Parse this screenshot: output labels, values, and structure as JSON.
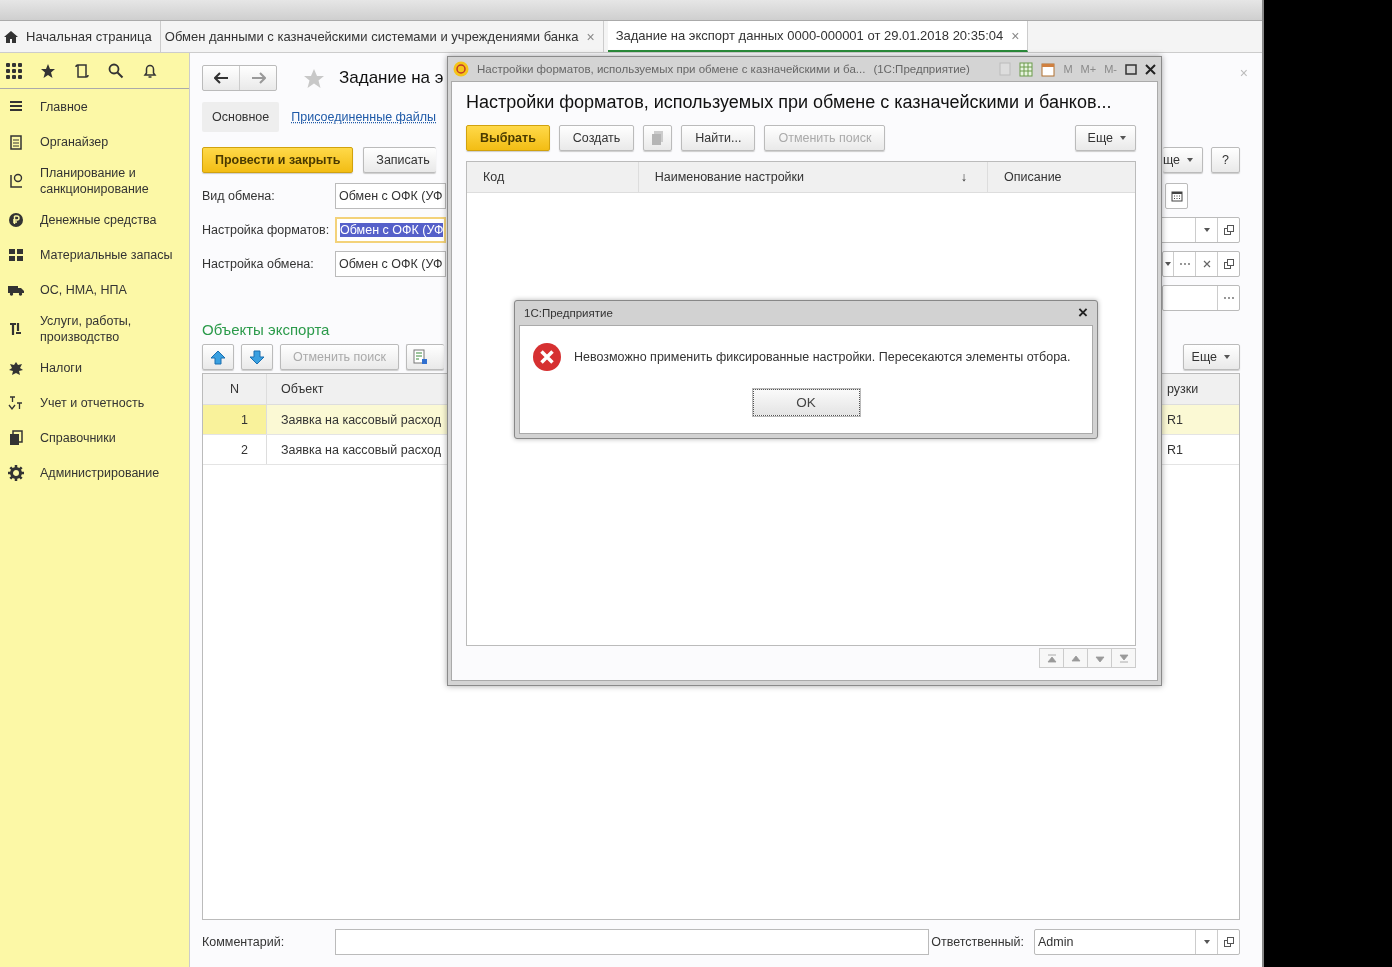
{
  "tabs": [
    {
      "label": "Начальная страница",
      "kind": "home",
      "selected": false
    },
    {
      "label": "Обмен данными с казначейскими системами и учреждениями банка",
      "kind": "doc",
      "selected": false,
      "close": "×"
    },
    {
      "label": "Задание на экспорт данных 0000-000001 от 29.01.2018 20:35:04",
      "kind": "doc",
      "selected": true,
      "close": "×"
    }
  ],
  "sidebar": {
    "items": [
      {
        "label": "Главное"
      },
      {
        "label": "Органайзер"
      },
      {
        "label": "Планирование и санкционирование"
      },
      {
        "label": "Денежные средства"
      },
      {
        "label": "Материальные запасы"
      },
      {
        "label": "ОС, НМА, НПА"
      },
      {
        "label": "Услуги, работы, производство"
      },
      {
        "label": "Налоги"
      },
      {
        "label": "Учет и отчетность"
      },
      {
        "label": "Справочники"
      },
      {
        "label": "Администрирование"
      }
    ]
  },
  "form": {
    "title": "Задание на э",
    "close": "×",
    "tabs": [
      {
        "label": "Основное",
        "selected": true
      },
      {
        "label": "Присоединенные файлы",
        "selected": false
      }
    ],
    "commands": [
      {
        "label": "Провести и закрыть",
        "kind": "default"
      },
      {
        "label": "Записать",
        "kind": "plain"
      }
    ],
    "more": "ще",
    "help": "?",
    "fields": [
      {
        "label": "Вид обмена:",
        "value": "Обмен с ОФК (УФ",
        "focused": false,
        "right": [
          {
            "kind": "calendar"
          }
        ]
      },
      {
        "label": "Настройка форматов:",
        "value": "Обмен с ОФК (УФ",
        "focused": true,
        "right": [
          {
            "kind": "field"
          },
          {
            "kind": "dropdown"
          },
          {
            "kind": "open"
          }
        ]
      },
      {
        "label": "Настройка обмена:",
        "value": "Обмен с ОФК (УФ",
        "focused": false,
        "right": [
          {
            "kind": "dropdown"
          },
          {
            "kind": "choose"
          },
          {
            "kind": "clear"
          },
          {
            "kind": "open"
          }
        ]
      },
      {
        "right": [
          {
            "kind": "field"
          },
          {
            "kind": "choose"
          }
        ]
      }
    ],
    "section": "Объекты экспорта",
    "toolbar": {
      "cancel_search": "Отменить поиск",
      "more": "Еще"
    },
    "table": {
      "columns": [
        {
          "label": "N"
        },
        {
          "label": "Объект"
        },
        {
          "label": "рузки"
        }
      ],
      "rows": [
        {
          "cells": [
            "1",
            "Заявка на кассовый расход",
            "R1"
          ],
          "selected": true
        },
        {
          "cells": [
            "2",
            "Заявка на кассовый расход",
            "R1"
          ],
          "selected": false
        }
      ]
    },
    "footer": {
      "comment_label": "Комментарий:",
      "responsible_label": "Ответственный:",
      "responsible": "Admin"
    }
  },
  "dialog": {
    "title": "Настройки форматов, используемых при обмене с казначейскими и ба...",
    "app": "(1С:Предприятие)",
    "memory": [
      "M",
      "M+",
      "M-"
    ],
    "heading": "Настройки форматов, используемых при обмене с казначейскими и банков...",
    "buttons": [
      {
        "label": "Выбрать",
        "kind": "default",
        "disabled": false
      },
      {
        "label": "Создать",
        "kind": "plain",
        "disabled": false
      },
      {
        "kind": "icon",
        "disabled": true
      },
      {
        "label": "Найти...",
        "kind": "plain",
        "disabled": false
      },
      {
        "label": "Отменить поиск",
        "kind": "plain",
        "disabled": true
      }
    ],
    "more": "Еще",
    "columns": [
      {
        "label": "Код"
      },
      {
        "label": "Наименование настройки",
        "sort": "↓"
      },
      {
        "label": "Описание"
      }
    ]
  },
  "alert": {
    "title": "1С:Предприятие",
    "close": "×",
    "message": "Невозможно применить фиксированные настройки. Пересекаются элементы отбора.",
    "ok": "OK"
  }
}
